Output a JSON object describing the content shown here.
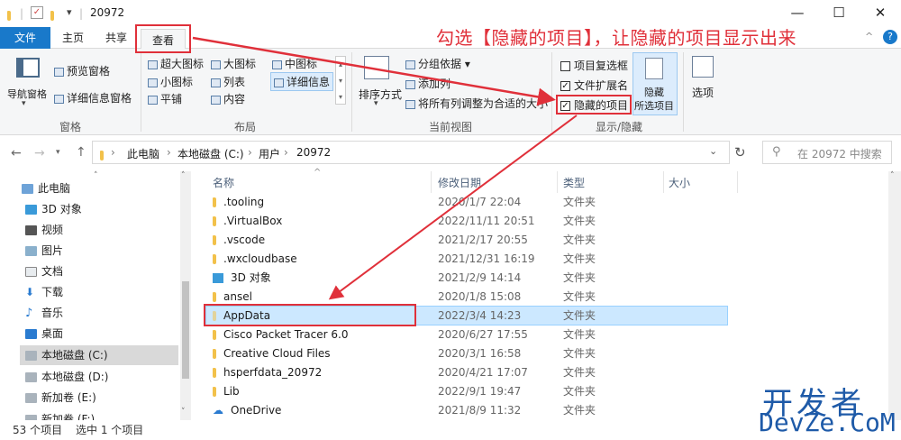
{
  "window": {
    "title": "20972",
    "minimize": "—",
    "maximize": "☐",
    "close": "✕"
  },
  "tabs": {
    "file": "文件",
    "home": "主页",
    "share": "共享",
    "view": "查看"
  },
  "ribbon": {
    "nav_pane": "导航窗格",
    "preview_pane": "预览窗格",
    "details_pane": "详细信息窗格",
    "pane_group": "窗格",
    "layout": {
      "xl_icons": "超大图标",
      "large_icons": "大图标",
      "medium_icons": "中图标",
      "small_icons": "小图标",
      "list": "列表",
      "details": "详细信息",
      "tiles": "平铺",
      "content": "内容",
      "group": "布局"
    },
    "sort_by": "排序方式",
    "group_by": "分组依据",
    "add_column": "添加列",
    "fit_columns": "将所有列调整为合适的大小",
    "current_view_group": "当前视图",
    "item_checkboxes": "项目复选框",
    "file_extensions": "文件扩展名",
    "hidden_items": "隐藏的项目",
    "hide_selected_1": "隐藏",
    "hide_selected_2": "所选项目",
    "show_hide_group": "显示/隐藏",
    "options": "选项"
  },
  "annotation": "勾选【隐藏的项目】，让隐藏的项目显示出来",
  "address": {
    "path": [
      "此电脑",
      "本地磁盘 (C:)",
      "用户",
      "20972"
    ],
    "search_placeholder": "在 20972 中搜索"
  },
  "nav": [
    {
      "label": "此电脑"
    },
    {
      "label": "3D 对象"
    },
    {
      "label": "视频"
    },
    {
      "label": "图片"
    },
    {
      "label": "文档"
    },
    {
      "label": "下载"
    },
    {
      "label": "音乐"
    },
    {
      "label": "桌面"
    },
    {
      "label": "本地磁盘 (C:)"
    },
    {
      "label": "本地磁盘 (D:)"
    },
    {
      "label": "新加卷 (E:)"
    },
    {
      "label": "新加卷 (F:)"
    }
  ],
  "columns": {
    "name": "名称",
    "date": "修改日期",
    "type": "类型",
    "size": "大小"
  },
  "files": [
    {
      "name": ".tooling",
      "date": "2020/1/7 22:04",
      "type": "文件夹"
    },
    {
      "name": ".VirtualBox",
      "date": "2022/11/11 20:51",
      "type": "文件夹"
    },
    {
      "name": ".vscode",
      "date": "2021/2/17 20:55",
      "type": "文件夹"
    },
    {
      "name": ".wxcloudbase",
      "date": "2021/12/31 16:19",
      "type": "文件夹"
    },
    {
      "name": "3D 对象",
      "date": "2021/2/9 14:14",
      "type": "文件夹"
    },
    {
      "name": "ansel",
      "date": "2020/1/8 15:08",
      "type": "文件夹"
    },
    {
      "name": "AppData",
      "date": "2022/3/4 14:23",
      "type": "文件夹"
    },
    {
      "name": "Cisco Packet Tracer 6.0",
      "date": "2020/6/27 17:55",
      "type": "文件夹"
    },
    {
      "name": "Creative Cloud Files",
      "date": "2020/3/1 16:58",
      "type": "文件夹"
    },
    {
      "name": "hsperfdata_20972",
      "date": "2020/4/21 17:07",
      "type": "文件夹"
    },
    {
      "name": "Lib",
      "date": "2022/9/1 19:47",
      "type": "文件夹"
    },
    {
      "name": "OneDrive",
      "date": "2021/8/9 11:32",
      "type": "文件夹"
    }
  ],
  "status": {
    "count": "53 个项目",
    "selected": "选中 1 个项目"
  },
  "watermark": {
    "line1": "开发者",
    "line2": "DevZe.CoM"
  }
}
